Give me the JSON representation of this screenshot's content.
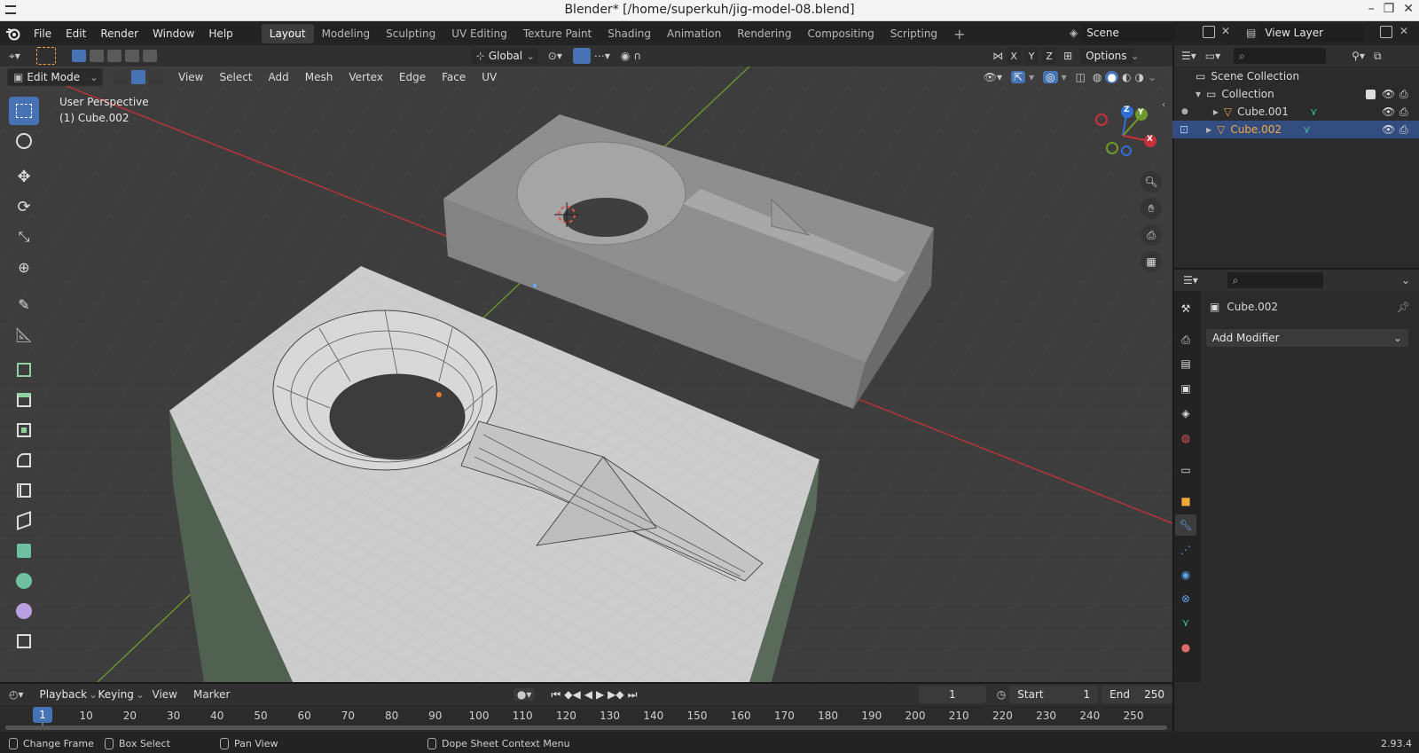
{
  "window": {
    "title": "Blender* [/home/superkuh/jig-model-08.blend]"
  },
  "menubar": {
    "items": [
      "File",
      "Edit",
      "Render",
      "Window",
      "Help"
    ]
  },
  "workspaces": [
    "Layout",
    "Modeling",
    "Sculpting",
    "UV Editing",
    "Texture Paint",
    "Shading",
    "Animation",
    "Rendering",
    "Compositing",
    "Scripting"
  ],
  "active_workspace": "Layout",
  "scene": {
    "name": "Scene"
  },
  "view_layer": {
    "name": "View Layer"
  },
  "viewport_header": {
    "mode": "Edit Mode",
    "menus": [
      "View",
      "Select",
      "Add",
      "Mesh",
      "Vertex",
      "Edge",
      "Face",
      "UV"
    ],
    "orientation": "Global",
    "options_label": "Options",
    "axes": [
      "X",
      "Y",
      "Z"
    ]
  },
  "viewport": {
    "perspective_label": "User Perspective",
    "object_label": "(1) Cube.002",
    "gizmo_axes": [
      "Z",
      "Y",
      "X"
    ]
  },
  "outliner": {
    "scene_collection": "Scene Collection",
    "collection": "Collection",
    "items": [
      {
        "name": "Cube.001",
        "selected": false
      },
      {
        "name": "Cube.002",
        "selected": true
      }
    ]
  },
  "properties": {
    "object_name": "Cube.002",
    "add_modifier_label": "Add Modifier"
  },
  "timeline": {
    "menus": [
      "Playback",
      "Keying",
      "View",
      "Marker"
    ],
    "current_frame": "1",
    "start_label": "Start",
    "start_value": "1",
    "end_label": "End",
    "end_value": "250",
    "ruler_current": "1",
    "ruler_ticks": [
      "10",
      "20",
      "30",
      "40",
      "50",
      "60",
      "70",
      "80",
      "90",
      "100",
      "110",
      "120",
      "130",
      "140",
      "150",
      "160",
      "170",
      "180",
      "190",
      "200",
      "210",
      "220",
      "230",
      "240",
      "250"
    ]
  },
  "statusbar": {
    "items": [
      "Change Frame",
      "Box Select",
      "Pan View",
      "Dope Sheet Context Menu"
    ],
    "version": "2.93.4"
  },
  "colors": {
    "accent": "#4772b3",
    "x_axis": "#c8303a",
    "y_axis": "#6e9a2b",
    "z_axis": "#2f6fd6",
    "selected_text": "#f3a83d",
    "wrench": "#5fa3e8"
  }
}
